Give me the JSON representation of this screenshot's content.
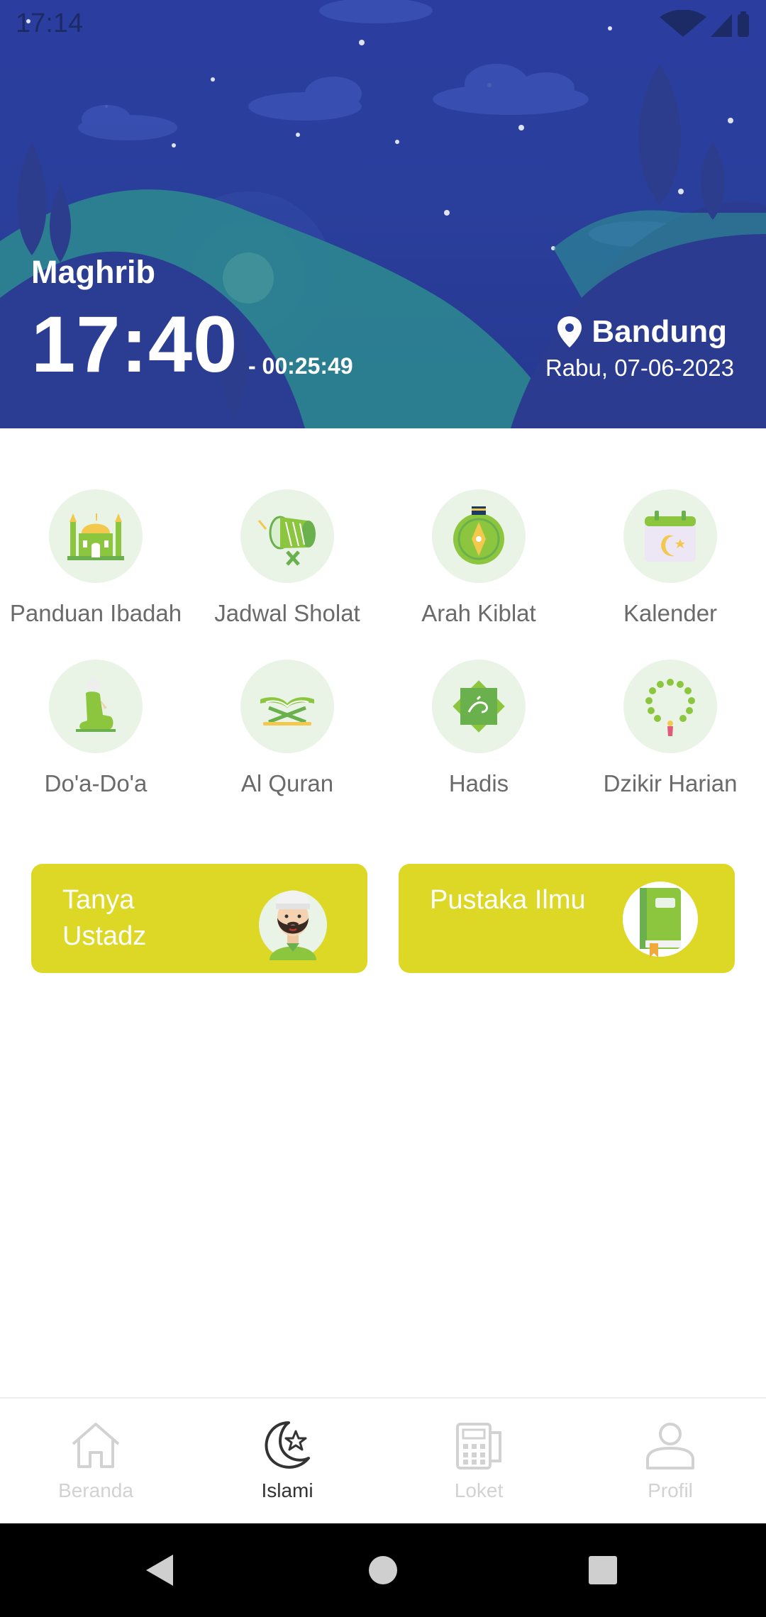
{
  "status_bar": {
    "time": "17:14"
  },
  "header": {
    "prayer_name": "Maghrib",
    "prayer_time": "17:40",
    "countdown": "- 00:25:49",
    "city": "Bandung",
    "date": "Rabu, 07-06-2023"
  },
  "menu": {
    "items": [
      {
        "label": "Panduan Ibadah",
        "icon": "mosque-icon"
      },
      {
        "label": "Jadwal Sholat",
        "icon": "drum-icon"
      },
      {
        "label": "Arah Kiblat",
        "icon": "compass-kaaba-icon"
      },
      {
        "label": "Kalender",
        "icon": "calendar-moon-icon"
      },
      {
        "label": "Do'a-Do'a",
        "icon": "praying-man-icon"
      },
      {
        "label": "Al Quran",
        "icon": "quran-stand-icon"
      },
      {
        "label": "Hadis",
        "icon": "hadis-star-icon"
      },
      {
        "label": "Dzikir Harian",
        "icon": "prayer-beads-icon"
      }
    ]
  },
  "promos": {
    "tanya_ustadz": "Tanya Ustadz",
    "pustaka_ilmu": "Pustaka Ilmu"
  },
  "bottom_nav": {
    "items": [
      {
        "label": "Beranda",
        "icon": "home-icon",
        "active": false
      },
      {
        "label": "Islami",
        "icon": "crescent-star-icon",
        "active": true
      },
      {
        "label": "Loket",
        "icon": "calculator-icon",
        "active": false
      },
      {
        "label": "Profil",
        "icon": "user-icon",
        "active": false
      }
    ]
  },
  "colors": {
    "hero_blue": "#2b3ea0",
    "accent_yellow": "#dcd825",
    "icon_bg": "#e9f4e7"
  }
}
